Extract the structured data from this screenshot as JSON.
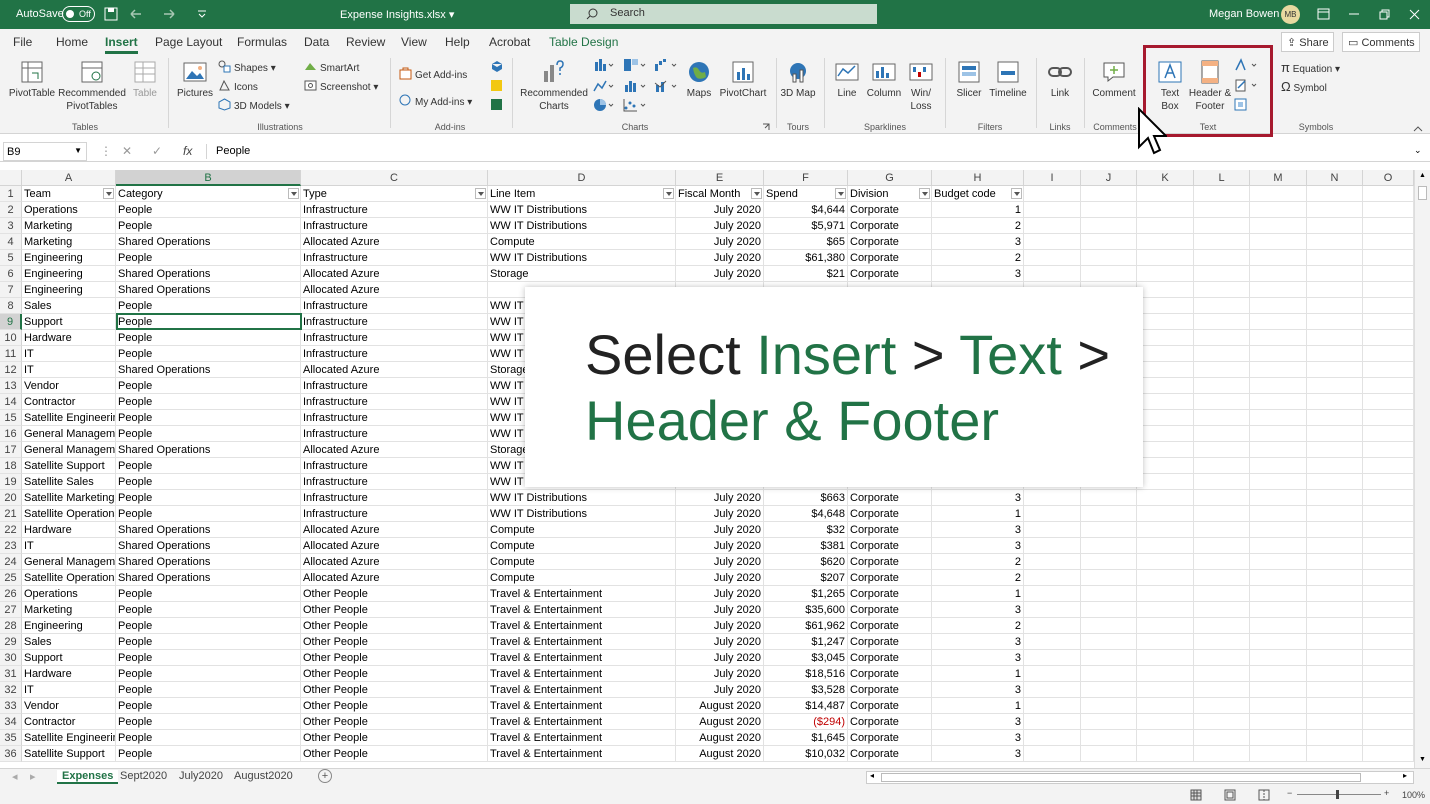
{
  "titlebar": {
    "autosave_label": "AutoSave",
    "autosave_state": "Off",
    "filename": "Expense Insights.xlsx",
    "search_placeholder": "Search",
    "user_name": "Megan Bowen",
    "user_initials": "MB"
  },
  "menu": {
    "tabs": [
      "File",
      "Home",
      "Insert",
      "Page Layout",
      "Formulas",
      "Data",
      "Review",
      "View",
      "Help",
      "Acrobat",
      "Table Design"
    ],
    "active_tab": "Insert",
    "share_label": "Share",
    "comments_label": "Comments"
  },
  "ribbon": {
    "pivot_table": "PivotTable",
    "recommended_pivot": "Recommended PivotTables",
    "table": "Table",
    "group_tables": "Tables",
    "pictures": "Pictures",
    "shapes": "Shapes",
    "icons": "Icons",
    "models_3d": "3D Models",
    "smartart": "SmartArt",
    "screenshot": "Screenshot",
    "group_illustrations": "Illustrations",
    "get_addins": "Get Add-ins",
    "my_addins": "My Add-ins",
    "group_addins": "Add-ins",
    "recommended_charts": "Recommended Charts",
    "maps": "Maps",
    "pivot_chart": "PivotChart",
    "group_charts": "Charts",
    "map_3d": "3D Map",
    "group_tours": "Tours",
    "line": "Line",
    "column": "Column",
    "win_loss": "Win/ Loss",
    "group_sparklines": "Sparklines",
    "slicer": "Slicer",
    "timeline": "Timeline",
    "group_filters": "Filters",
    "link": "Link",
    "group_links": "Links",
    "comment": "Comment",
    "group_comments": "Comments",
    "text_box": "Text Box",
    "header_footer": "Header & Footer",
    "group_text": "Text",
    "equation": "Equation",
    "symbol": "Symbol",
    "group_symbols": "Symbols"
  },
  "formula_bar": {
    "name_box": "B9",
    "cancel_glyph": "✕",
    "enter_glyph": "✓",
    "fx_glyph": "fx",
    "value": "People"
  },
  "columns": [
    "A",
    "B",
    "C",
    "D",
    "E",
    "F",
    "G",
    "H",
    "I",
    "J",
    "K",
    "L",
    "M",
    "N",
    "O"
  ],
  "headers": [
    "Team",
    "Category",
    "Type",
    "Line Item",
    "Fiscal Month",
    "Spend",
    "Division",
    "Budget code"
  ],
  "rows": [
    [
      "Operations",
      "People",
      "Infrastructure",
      "WW IT Distributions",
      "July 2020",
      "$4,644",
      "Corporate",
      "1"
    ],
    [
      "Marketing",
      "People",
      "Infrastructure",
      "WW IT Distributions",
      "July 2020",
      "$5,971",
      "Corporate",
      "2"
    ],
    [
      "Marketing",
      "Shared Operations",
      "Allocated Azure",
      "Compute",
      "July 2020",
      "$65",
      "Corporate",
      "3"
    ],
    [
      "Engineering",
      "People",
      "Infrastructure",
      "WW IT Distributions",
      "July 2020",
      "$61,380",
      "Corporate",
      "2"
    ],
    [
      "Engineering",
      "Shared Operations",
      "Allocated Azure",
      "Storage",
      "July 2020",
      "$21",
      "Corporate",
      "3"
    ],
    [
      "Engineering",
      "Shared Operations",
      "Allocated Azure",
      "",
      "",
      "",
      "",
      ""
    ],
    [
      "Sales",
      "People",
      "Infrastructure",
      "WW IT",
      "",
      "",
      "",
      ""
    ],
    [
      "Support",
      "People",
      "Infrastructure",
      "WW IT",
      "",
      "",
      "",
      ""
    ],
    [
      "Hardware",
      "People",
      "Infrastructure",
      "WW IT",
      "",
      "",
      "",
      ""
    ],
    [
      "IT",
      "People",
      "Infrastructure",
      "WW IT",
      "",
      "",
      "",
      ""
    ],
    [
      "IT",
      "Shared Operations",
      "Allocated Azure",
      "Storage",
      "",
      "",
      "",
      ""
    ],
    [
      "Vendor",
      "People",
      "Infrastructure",
      "WW IT",
      "",
      "",
      "",
      ""
    ],
    [
      "Contractor",
      "People",
      "Infrastructure",
      "WW IT",
      "",
      "",
      "",
      ""
    ],
    [
      "Satellite Engineering",
      "People",
      "Infrastructure",
      "WW IT",
      "",
      "",
      "",
      ""
    ],
    [
      "General Management",
      "People",
      "Infrastructure",
      "WW IT",
      "",
      "",
      "",
      ""
    ],
    [
      "General Management",
      "Shared Operations",
      "Allocated Azure",
      "Storage",
      "",
      "",
      "",
      ""
    ],
    [
      "Satellite Support",
      "People",
      "Infrastructure",
      "WW IT",
      "",
      "",
      "",
      ""
    ],
    [
      "Satellite Sales",
      "People",
      "Infrastructure",
      "WW IT",
      "",
      "",
      "",
      ""
    ],
    [
      "Satellite Marketing",
      "People",
      "Infrastructure",
      "WW IT Distributions",
      "July 2020",
      "$663",
      "Corporate",
      "3"
    ],
    [
      "Satellite Operations",
      "People",
      "Infrastructure",
      "WW IT Distributions",
      "July 2020",
      "$4,648",
      "Corporate",
      "1"
    ],
    [
      "Hardware",
      "Shared Operations",
      "Allocated Azure",
      "Compute",
      "July 2020",
      "$32",
      "Corporate",
      "3"
    ],
    [
      "IT",
      "Shared Operations",
      "Allocated Azure",
      "Compute",
      "July 2020",
      "$381",
      "Corporate",
      "3"
    ],
    [
      "General Management",
      "Shared Operations",
      "Allocated Azure",
      "Compute",
      "July 2020",
      "$620",
      "Corporate",
      "2"
    ],
    [
      "Satellite Operations",
      "Shared Operations",
      "Allocated Azure",
      "Compute",
      "July 2020",
      "$207",
      "Corporate",
      "2"
    ],
    [
      "Operations",
      "People",
      "Other People",
      "Travel & Entertainment",
      "July 2020",
      "$1,265",
      "Corporate",
      "1"
    ],
    [
      "Marketing",
      "People",
      "Other People",
      "Travel & Entertainment",
      "July 2020",
      "$35,600",
      "Corporate",
      "3"
    ],
    [
      "Engineering",
      "People",
      "Other People",
      "Travel & Entertainment",
      "July 2020",
      "$61,962",
      "Corporate",
      "2"
    ],
    [
      "Sales",
      "People",
      "Other People",
      "Travel & Entertainment",
      "July 2020",
      "$1,247",
      "Corporate",
      "3"
    ],
    [
      "Support",
      "People",
      "Other People",
      "Travel & Entertainment",
      "July 2020",
      "$3,045",
      "Corporate",
      "3"
    ],
    [
      "Hardware",
      "People",
      "Other People",
      "Travel & Entertainment",
      "July 2020",
      "$18,516",
      "Corporate",
      "1"
    ],
    [
      "IT",
      "People",
      "Other People",
      "Travel & Entertainment",
      "July 2020",
      "$3,528",
      "Corporate",
      "3"
    ],
    [
      "Vendor",
      "People",
      "Other People",
      "Travel & Entertainment",
      "August 2020",
      "$14,487",
      "Corporate",
      "1"
    ],
    [
      "Contractor",
      "People",
      "Other People",
      "Travel & Entertainment",
      "August 2020",
      "($294)",
      "Corporate",
      "3"
    ],
    [
      "Satellite Engineering",
      "People",
      "Other People",
      "Travel & Entertainment",
      "August 2020",
      "$1,645",
      "Corporate",
      "3"
    ],
    [
      "Satellite Support",
      "People",
      "Other People",
      "Travel & Entertainment",
      "August 2020",
      "$10,032",
      "Corporate",
      "3"
    ]
  ],
  "callout": {
    "word1": "Select",
    "word2": "Insert",
    "sep1": ">",
    "word3": "Text",
    "sep2": ">",
    "line2": "Header & Footer"
  },
  "sheets": [
    "Expenses",
    "Sept2020",
    "July2020",
    "August2020"
  ],
  "active_sheet": "Expenses",
  "status": {
    "zoom": "100%"
  },
  "colors": {
    "accent": "#217346",
    "highlight_box": "#a6192e",
    "negative": "#c00000"
  }
}
